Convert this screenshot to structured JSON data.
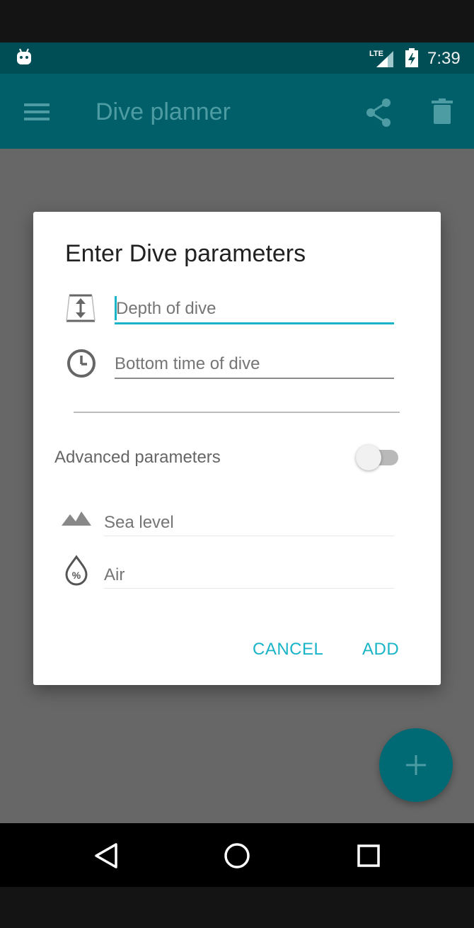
{
  "status_bar": {
    "time": "7:39",
    "network": "LTE"
  },
  "app_bar": {
    "title": "Dive planner"
  },
  "dialog": {
    "title": "Enter Dive parameters",
    "depth": {
      "placeholder": "Depth of dive",
      "value": ""
    },
    "bottom_time": {
      "placeholder": "Bottom time of dive",
      "value": ""
    },
    "advanced_label": "Advanced parameters",
    "advanced_enabled": false,
    "sea_level": {
      "placeholder": "Sea level",
      "value": ""
    },
    "gas": {
      "placeholder": "Air",
      "value": ""
    },
    "cancel_label": "CANCEL",
    "add_label": "ADD"
  },
  "colors": {
    "accent": "#19B4C8",
    "status_bar": "#004E55",
    "app_bar": "#015F69",
    "fab": "#006A74"
  },
  "icons": {
    "status": [
      "android-icon",
      "lte-signal-icon",
      "battery-charging-icon"
    ],
    "app_bar": [
      "menu-icon",
      "share-icon",
      "delete-icon"
    ],
    "fields": [
      "depth-icon",
      "clock-icon",
      "mountain-icon",
      "gas-percent-icon"
    ],
    "nav": [
      "back-icon",
      "home-icon",
      "recents-icon"
    ],
    "fab": "add-icon"
  }
}
